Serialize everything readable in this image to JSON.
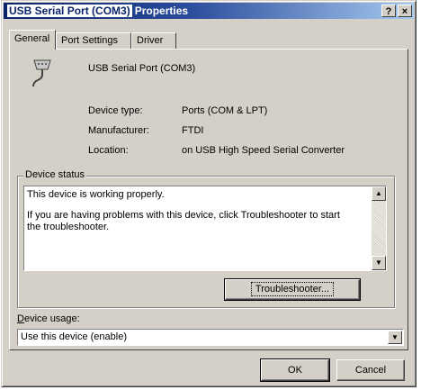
{
  "window": {
    "title_main": "USB Serial Port (COM3)",
    "title_rest": "Properties",
    "help_label": "?",
    "close_label": "×"
  },
  "tabs": [
    {
      "label": "General",
      "active": true
    },
    {
      "label": "Port Settings",
      "active": false
    },
    {
      "label": "Driver",
      "active": false
    }
  ],
  "device": {
    "name": "USB Serial Port (COM3)",
    "icon": "serial-port-icon",
    "fields": [
      {
        "label": "Device type:",
        "value": "Ports (COM & LPT)"
      },
      {
        "label": "Manufacturer:",
        "value": "FTDI"
      },
      {
        "label": "Location:",
        "value": "on USB High Speed Serial Converter"
      }
    ]
  },
  "status": {
    "group_label": "Device status",
    "line1": "This device is working properly.",
    "line2": "If you are having problems with this device, click Troubleshooter to start the troubleshooter.",
    "troubleshoot_label": "Troubleshooter..."
  },
  "usage": {
    "label": "Device usage:",
    "value": "Use this device (enable)"
  },
  "buttons": {
    "ok": "OK",
    "cancel": "Cancel"
  },
  "colors": {
    "title_active": "#0a246a",
    "face": "#d4d0c8"
  }
}
